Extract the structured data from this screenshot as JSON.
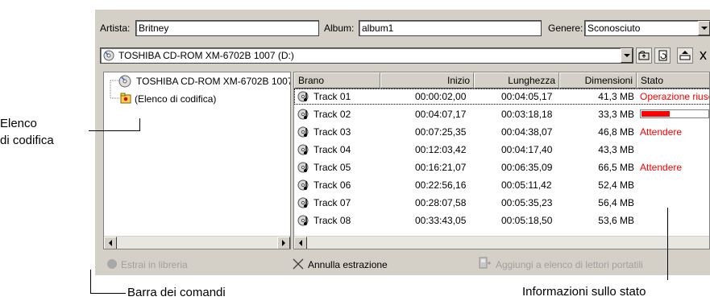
{
  "fields": {
    "artist_label": "Artista:",
    "artist_value": "Britney",
    "album_label": "Album:",
    "album_value": "album1",
    "genre_label": "Genere:",
    "genre_value": "Sconosciuto"
  },
  "drive": {
    "selected": "TOSHIBA CD-ROM XM-6702B 1007 (D:)"
  },
  "tree": {
    "items": [
      "TOSHIBA CD-ROM XM-6702B 1007",
      "(Elenco di codifica)"
    ]
  },
  "list": {
    "columns": [
      "Brano",
      "Inizio",
      "Lunghezza",
      "Dimensioni",
      "Stato"
    ],
    "rows": [
      {
        "track": "Track 01",
        "start": "00:00:02,00",
        "length": "00:04:05,17",
        "size": "41,3 MB",
        "status": "Operazione riuscita"
      },
      {
        "track": "Track 02",
        "start": "00:04:07,17",
        "length": "00:03:18,18",
        "size": "33,3 MB",
        "status": "",
        "progress": 0.42
      },
      {
        "track": "Track 03",
        "start": "00:07:25,35",
        "length": "00:04:38,07",
        "size": "46,8 MB",
        "status": "Attendere"
      },
      {
        "track": "Track 04",
        "start": "00:12:03,42",
        "length": "00:04:17,40",
        "size": "43,3 MB",
        "status": ""
      },
      {
        "track": "Track 05",
        "start": "00:16:21,07",
        "length": "00:06:35,09",
        "size": "66,5 MB",
        "status": "Attendere"
      },
      {
        "track": "Track 06",
        "start": "00:22:56,16",
        "length": "00:05:11,42",
        "size": "52,4 MB",
        "status": ""
      },
      {
        "track": "Track 07",
        "start": "00:28:07,58",
        "length": "00:05:35,23",
        "size": "56,4 MB",
        "status": ""
      },
      {
        "track": "Track 08",
        "start": "00:33:43,05",
        "length": "00:05:18,50",
        "size": "53,6 MB",
        "status": ""
      }
    ]
  },
  "commands": {
    "extract_to_library": "Estrai in libreria",
    "cancel_extraction": "Annulla estrazione",
    "add_to_portable": "Aggiungi a elenco di lettori portatili"
  },
  "callouts": {
    "encoding_list_line1": "Elenco",
    "encoding_list_line2": "di codifica",
    "command_bar": "Barra dei comandi",
    "status_info": "Informazioni sullo stato"
  },
  "colors": {
    "status_red": "#ff0000",
    "panel_gray": "#d4d0c8",
    "disabled_text": "#a0a0a0"
  }
}
